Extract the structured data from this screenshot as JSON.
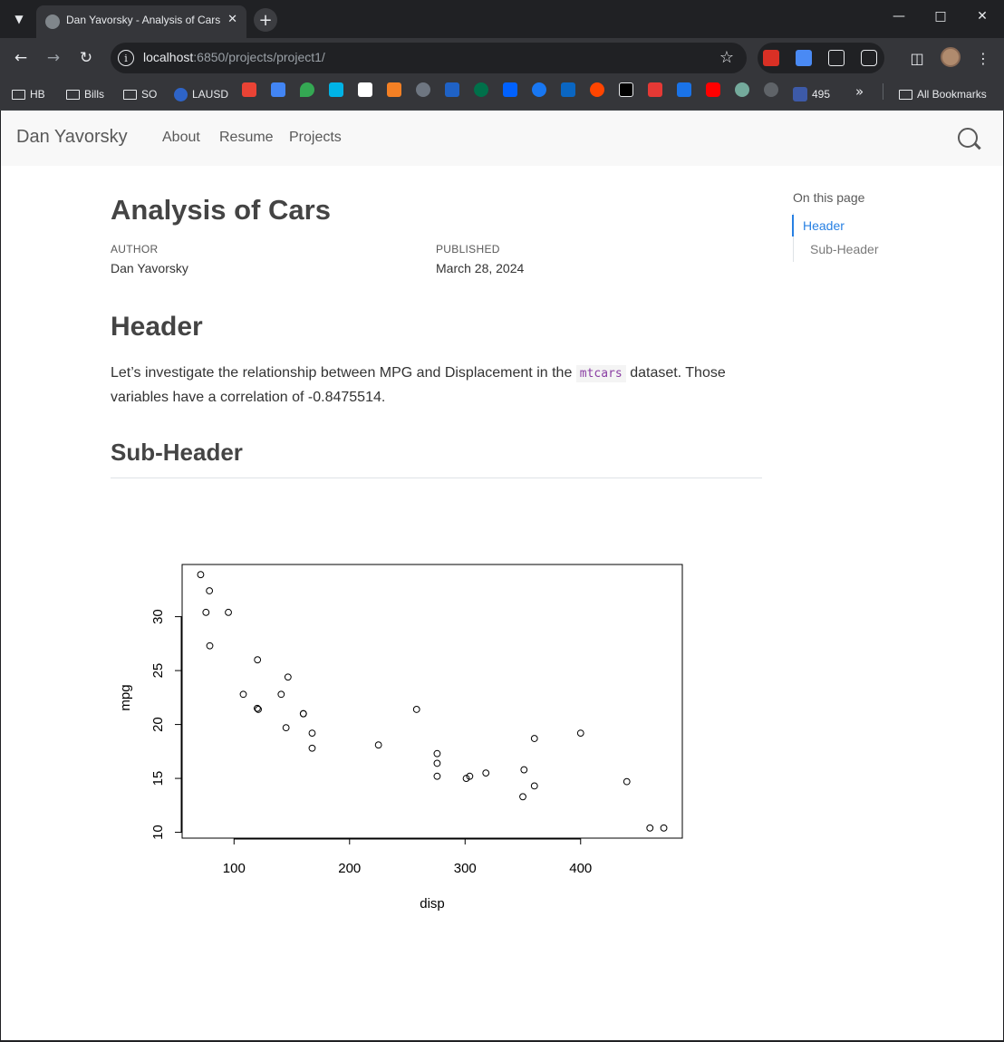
{
  "browser": {
    "tab_title": "Dan Yavorsky - Analysis of Cars",
    "url_host": "localhost",
    "url_rest": ":6850/projects/project1/",
    "bookmarks": [
      {
        "label": "HB"
      },
      {
        "label": "Bills"
      },
      {
        "label": "SO"
      },
      {
        "label": "LAUSD"
      },
      {
        "label": "495"
      },
      {
        "label": "All Bookmarks"
      }
    ]
  },
  "site": {
    "brand": "Dan Yavorsky",
    "nav": [
      "About",
      "Resume",
      "Projects"
    ]
  },
  "doc": {
    "title": "Analysis of Cars",
    "author_label": "AUTHOR",
    "author": "Dan Yavorsky",
    "published_label": "PUBLISHED",
    "published": "March 28, 2024",
    "header": "Header",
    "para_before": "Let’s investigate the relationship between MPG and Displacement in the ",
    "para_code": "mtcars",
    "para_after": " dataset. Those variables have a correlation of -0.8475514.",
    "subheader": "Sub-Header"
  },
  "toc": {
    "title": "On this page",
    "items": [
      "Header",
      "Sub-Header"
    ]
  },
  "chart_data": {
    "type": "scatter",
    "xlabel": "disp",
    "ylabel": "mpg",
    "xlim": [
      71.1,
      472
    ],
    "ylim": [
      10.4,
      33.9
    ],
    "xticks": [
      100,
      200,
      300,
      400
    ],
    "yticks": [
      10,
      15,
      20,
      25,
      30
    ],
    "points": [
      [
        160,
        21.0
      ],
      [
        160,
        21.0
      ],
      [
        108,
        22.8
      ],
      [
        258,
        21.4
      ],
      [
        360,
        18.7
      ],
      [
        225,
        18.1
      ],
      [
        360,
        14.3
      ],
      [
        146.7,
        24.4
      ],
      [
        140.8,
        22.8
      ],
      [
        167.6,
        19.2
      ],
      [
        167.6,
        17.8
      ],
      [
        275.8,
        16.4
      ],
      [
        275.8,
        17.3
      ],
      [
        275.8,
        15.2
      ],
      [
        472,
        10.4
      ],
      [
        460,
        10.4
      ],
      [
        440,
        14.7
      ],
      [
        78.7,
        32.4
      ],
      [
        75.7,
        30.4
      ],
      [
        71.1,
        33.9
      ],
      [
        120.1,
        21.5
      ],
      [
        318,
        15.5
      ],
      [
        304,
        15.2
      ],
      [
        350,
        13.3
      ],
      [
        400,
        19.2
      ],
      [
        79,
        27.3
      ],
      [
        120.3,
        26.0
      ],
      [
        95.1,
        30.4
      ],
      [
        351,
        15.8
      ],
      [
        145,
        19.7
      ],
      [
        301,
        15.0
      ],
      [
        121,
        21.4
      ]
    ]
  }
}
